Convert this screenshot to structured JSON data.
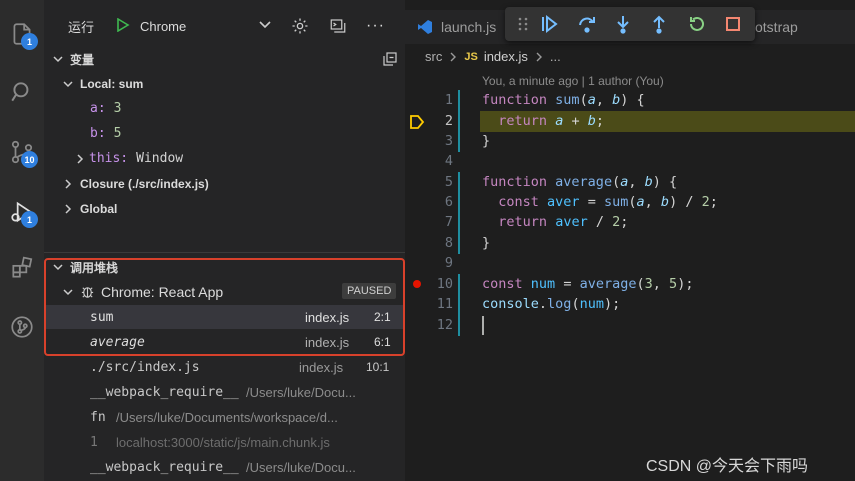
{
  "run": {
    "label": "运行",
    "config": "Chrome"
  },
  "activity": {
    "explorer_badge": "1",
    "scm_badge": "10",
    "debug_badge": "1"
  },
  "variables": {
    "header": "变量",
    "local": "Local: sum",
    "a_name": "a:",
    "a_value": "3",
    "b_name": "b:",
    "b_value": "5",
    "this_name": "this:",
    "this_value": "Window",
    "closure": "Closure (./src/index.js)",
    "global": "Global"
  },
  "call_stack": {
    "header": "调用堆栈",
    "session": "Chrome: React App",
    "status": "PAUSED",
    "frames": [
      {
        "fn": "sum",
        "file": "index.js",
        "pos": "2:1"
      },
      {
        "fn": "average",
        "file": "index.js",
        "pos": "6:1"
      },
      {
        "fn": "./src/index.js",
        "file": "index.js",
        "pos": "10:1"
      }
    ],
    "extra": [
      {
        "fn": "__webpack_require__",
        "path": "/Users/luke/Docu..."
      },
      {
        "fn": "fn",
        "path": "/Users/luke/Documents/workspace/d..."
      },
      {
        "fn": "1",
        "path": "localhost:3000/static/js/main.chunk.js"
      },
      {
        "fn": "__webpack_require__",
        "path": "/Users/luke/Docu..."
      }
    ]
  },
  "tabs": {
    "launch": "launch.js",
    "bootstrap": "otstrap"
  },
  "breadcrumb": {
    "folder": "src",
    "lang": "JS",
    "file": "index.js",
    "more": "..."
  },
  "blame": "You, a minute ago | 1 author (You)",
  "code": {
    "l1": "1",
    "l2": "2",
    "l3": "3",
    "l4": "4",
    "l5": "5",
    "l6": "6",
    "l7": "7",
    "l8": "8",
    "l9": "9",
    "l10": "10",
    "l11": "11",
    "l12": "12"
  },
  "watermark": "CSDN @今天会下雨吗",
  "colors": {
    "accent": "#2f7fde",
    "highlight_box": "#d8412b",
    "current_line": "#4b4b18",
    "breakpoint": "#e51400"
  }
}
